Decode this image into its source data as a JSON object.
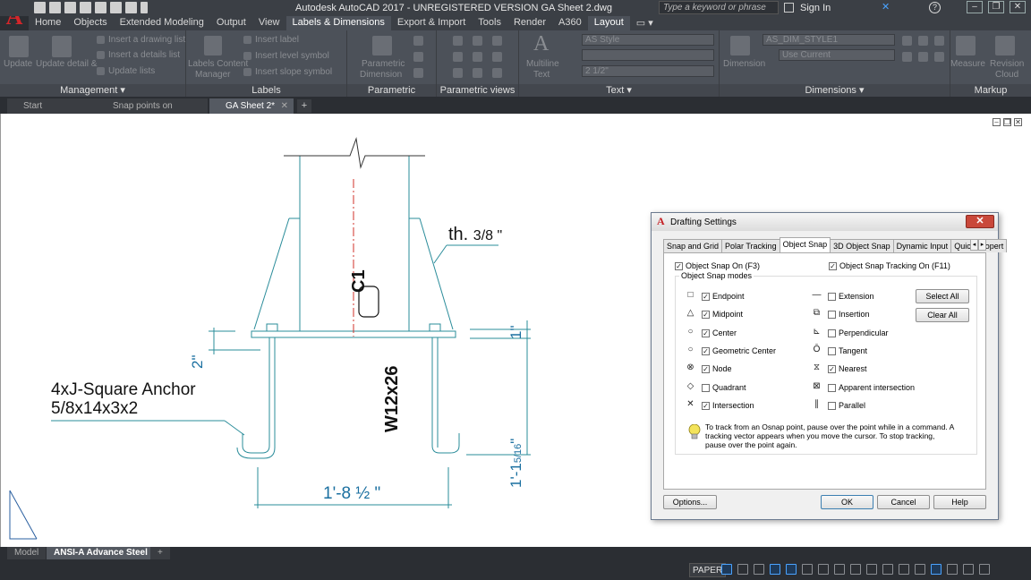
{
  "app": {
    "title": "Autodesk AutoCAD 2017 - UNREGISTERED VERSION    GA Sheet 2.dwg",
    "logo_letter": "A",
    "search_placeholder": "Type a keyword or phrase",
    "signin_label": "Sign In"
  },
  "ribbon_tabs": [
    "Home",
    "Objects",
    "Extended Modeling",
    "Output",
    "View",
    "Labels & Dimensions",
    "Export & Import",
    "Tools",
    "Render",
    "A360",
    "Layout"
  ],
  "active_ribbon_tab": "Labels & Dimensions",
  "ribbon_panels": {
    "management": {
      "label": "Management",
      "items": [
        "Update",
        "Update detail &",
        "Insert a drawing list",
        "Insert a details list",
        "Update lists"
      ]
    },
    "labels": {
      "label": "Labels",
      "items": [
        "Labels Content",
        "Manager",
        "Insert label",
        "Insert level symbol",
        "Insert slope symbol"
      ]
    },
    "parametric_dimensions": {
      "label": "Parametric Dimensions",
      "items": [
        "Parametric",
        "Dimension"
      ]
    },
    "parametric_views": {
      "label": "Parametric views"
    },
    "text": {
      "label": "Text",
      "items": [
        "Multiline",
        "Text"
      ],
      "style_value": "AS Style",
      "height_value": "2 1/2\""
    },
    "dimensions": {
      "label": "Dimensions",
      "items": [
        "Dimension"
      ],
      "style_value": "AS_DIM_STYLE1",
      "layer_value": "Use Current"
    },
    "markup": {
      "label": "Markup",
      "items": [
        "Measure",
        "Revision",
        "Cloud"
      ]
    }
  },
  "file_tabs": [
    {
      "label": "Start"
    },
    {
      "label": "Snap points on anchors*"
    },
    {
      "label": "GA Sheet 2*"
    }
  ],
  "active_file_tab": "GA Sheet 2*",
  "drawing": {
    "thickness_label": "th. ",
    "thickness_fraction": "3/8 \"",
    "column_tag": "C1",
    "column_section": "W12x26",
    "dim_plate": "2\"",
    "dim_top": "1\"",
    "dim_right_whole": "1'-1",
    "dim_right_frac": "5/16",
    "dim_right_quote": "\"",
    "dim_bottom": "1'-8 ½ \"",
    "anchor_line1": "4xJ-Square Anchor",
    "anchor_line2": "5/8x14x3x2"
  },
  "layout_tabs": [
    "Model",
    "ANSI-A  Advance Steel"
  ],
  "active_layout_tab": "ANSI-A  Advance Steel",
  "status": {
    "space": "PAPER"
  },
  "dialog": {
    "title": "Drafting Settings",
    "tabs": [
      "Snap and Grid",
      "Polar Tracking",
      "Object Snap",
      "3D Object Snap",
      "Dynamic Input",
      "Quick Propert"
    ],
    "active_tab": "Object Snap",
    "osnap_on": {
      "label": "Object Snap On (F3)",
      "checked": true
    },
    "osnap_tracking": {
      "label": "Object Snap Tracking On (F11)",
      "checked": true
    },
    "group_label": "Object Snap modes",
    "modes_left": [
      {
        "symbol": "□",
        "label": "Endpoint",
        "checked": true
      },
      {
        "symbol": "△",
        "label": "Midpoint",
        "checked": true
      },
      {
        "symbol": "○",
        "label": "Center",
        "checked": true
      },
      {
        "symbol": "○",
        "label": "Geometric Center",
        "checked": true
      },
      {
        "symbol": "⊗",
        "label": "Node",
        "checked": true
      },
      {
        "symbol": "◇",
        "label": "Quadrant",
        "checked": false
      },
      {
        "symbol": "✕",
        "label": "Intersection",
        "checked": true
      }
    ],
    "modes_right": [
      {
        "symbol": "—",
        "label": "Extension",
        "checked": false
      },
      {
        "symbol": "⧉",
        "label": "Insertion",
        "checked": false
      },
      {
        "symbol": "⊾",
        "label": "Perpendicular",
        "checked": false
      },
      {
        "symbol": "Ō",
        "label": "Tangent",
        "checked": false
      },
      {
        "symbol": "⧖",
        "label": "Nearest",
        "checked": true
      },
      {
        "symbol": "⊠",
        "label": "Apparent intersection",
        "checked": false
      },
      {
        "symbol": "∥",
        "label": "Parallel",
        "checked": false
      }
    ],
    "select_all": "Select All",
    "clear_all": "Clear All",
    "tip": "To track from an Osnap point, pause over the point while in a command.  A tracking vector appears when you move the cursor.  To stop tracking, pause over the point again.",
    "buttons": {
      "options": "Options...",
      "ok": "OK",
      "cancel": "Cancel",
      "help": "Help"
    },
    "close": "✕"
  },
  "colors": {
    "accent_blue": "#1a6fa0",
    "drawing_line": "#2a8c9a",
    "center_line": "#d0302a",
    "ui_dark": "#2b2e33",
    "ribbon_bg": "#4c5159"
  }
}
